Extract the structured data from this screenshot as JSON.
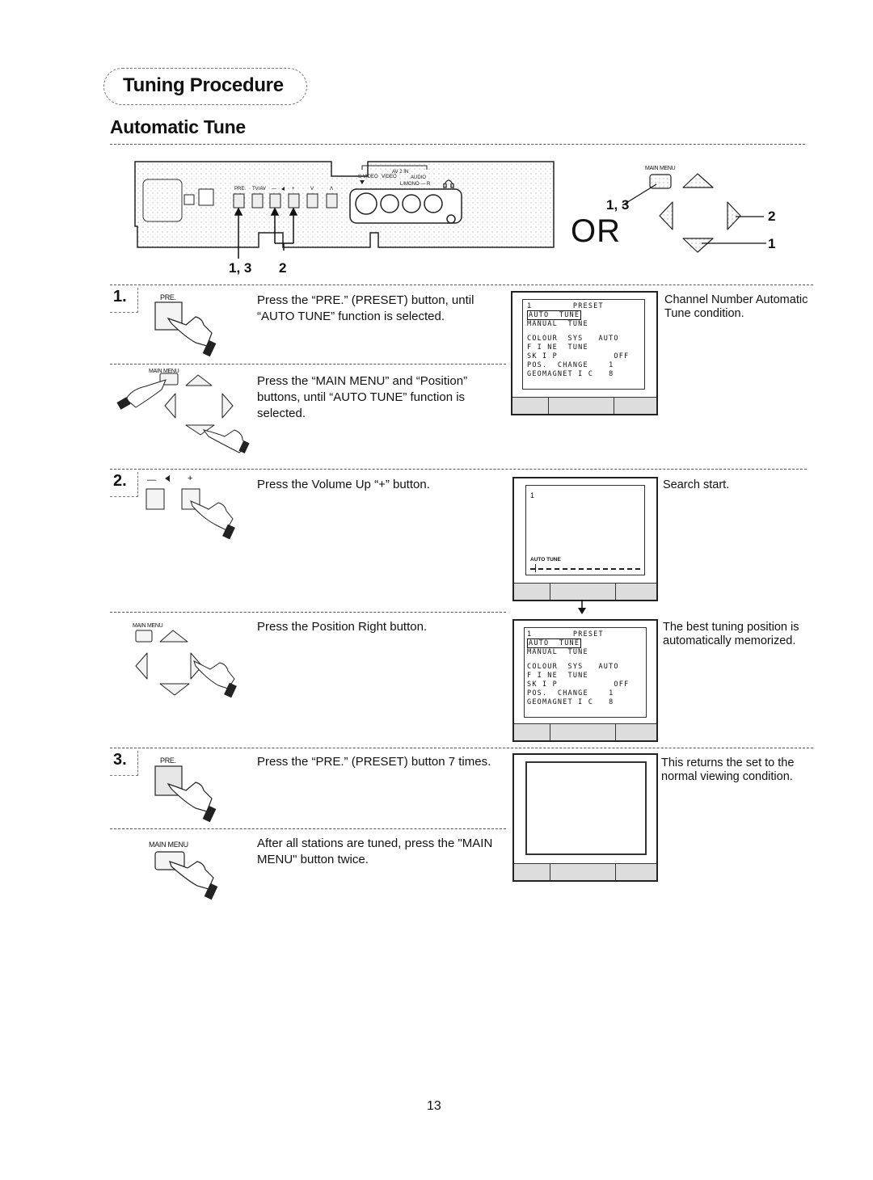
{
  "header": {
    "section_title": "Tuning Procedure",
    "subtitle": "Automatic Tune"
  },
  "front_panel": {
    "buttons": [
      "PRE.",
      "TV/AV",
      "—",
      "+",
      "V",
      "Λ"
    ],
    "volume_icon": "speaker-icon",
    "av_label": "AV 2 IN",
    "jack_labels": [
      "S-VIDEO",
      "VIDEO",
      "AUDIO",
      "L/MONO — R"
    ],
    "headphone_icon": "headphone-icon",
    "callouts": [
      "1, 3",
      "2"
    ]
  },
  "remote": {
    "main_menu_label": "MAIN MENU",
    "or_label": "OR",
    "callout_menu": "1, 3",
    "callout_right": "2",
    "callout_down": "1"
  },
  "steps": [
    {
      "number": "1.",
      "button_label": "PRE.",
      "instruction": "Press the “PRE.” (PRESET) button, until “AUTO TUNE” function is selected.",
      "alt_button_label": "MAIN MENU",
      "alt_instruction": "Press the “MAIN MENU” and “Position” buttons, until “AUTO TUNE” function is selected.",
      "screen": {
        "type": "menu",
        "channel": "1",
        "title": "PRESET",
        "items": [
          {
            "label": "AUTO  TUNE",
            "value": "",
            "highlighted": true
          },
          {
            "label": "MANUAL  TUNE",
            "value": "",
            "highlighted": false
          },
          {
            "label": "",
            "value": "",
            "highlighted": false
          },
          {
            "label": "COLOUR  SYS",
            "value": "AUTO",
            "highlighted": false
          },
          {
            "label": "F I NE  TUNE",
            "value": "",
            "highlighted": false
          },
          {
            "label": "SK I P",
            "value": "OFF",
            "highlighted": false
          },
          {
            "label": "POS.  CHANGE",
            "value": "1",
            "highlighted": false
          },
          {
            "label": "GEOMAGNET I C",
            "value": "8",
            "highlighted": false
          }
        ]
      },
      "note": "Channel Number Automatic Tune condition."
    },
    {
      "number": "2.",
      "button_labels": [
        "—",
        "+"
      ],
      "instruction": "Press the Volume Up “+” button.",
      "screen": {
        "type": "search",
        "channel": "1",
        "label": "AUTO TUNE"
      },
      "note": "Search start."
    },
    {
      "number": "",
      "button_label": "MAIN MENU",
      "instruction": "Press the Position Right button.",
      "screen": {
        "type": "menu",
        "channel": "1",
        "title": "PRESET",
        "items": [
          {
            "label": "AUTO  TUNE",
            "value": "",
            "highlighted": true
          },
          {
            "label": "MANUAL  TUNE",
            "value": "",
            "highlighted": false
          },
          {
            "label": "",
            "value": "",
            "highlighted": false
          },
          {
            "label": "COLOUR  SYS",
            "value": "AUTO",
            "highlighted": false
          },
          {
            "label": "F I NE  TUNE",
            "value": "",
            "highlighted": false
          },
          {
            "label": "SK I P",
            "value": "OFF",
            "highlighted": false
          },
          {
            "label": "POS.  CHANGE",
            "value": "1",
            "highlighted": false
          },
          {
            "label": "GEOMAGNET I C",
            "value": "8",
            "highlighted": false
          }
        ]
      },
      "note": "The best tuning position is automatically memorized."
    },
    {
      "number": "3.",
      "button_label": "PRE.",
      "instruction": "Press the “PRE.” (PRESET) button 7 times.",
      "alt_button_label": "MAIN MENU",
      "alt_instruction": "After all stations are tuned, press the \"MAIN MENU\" button twice.",
      "screen": {
        "type": "blank"
      },
      "note": "This returns the set to the normal viewing condition."
    }
  ],
  "page_number": "13"
}
